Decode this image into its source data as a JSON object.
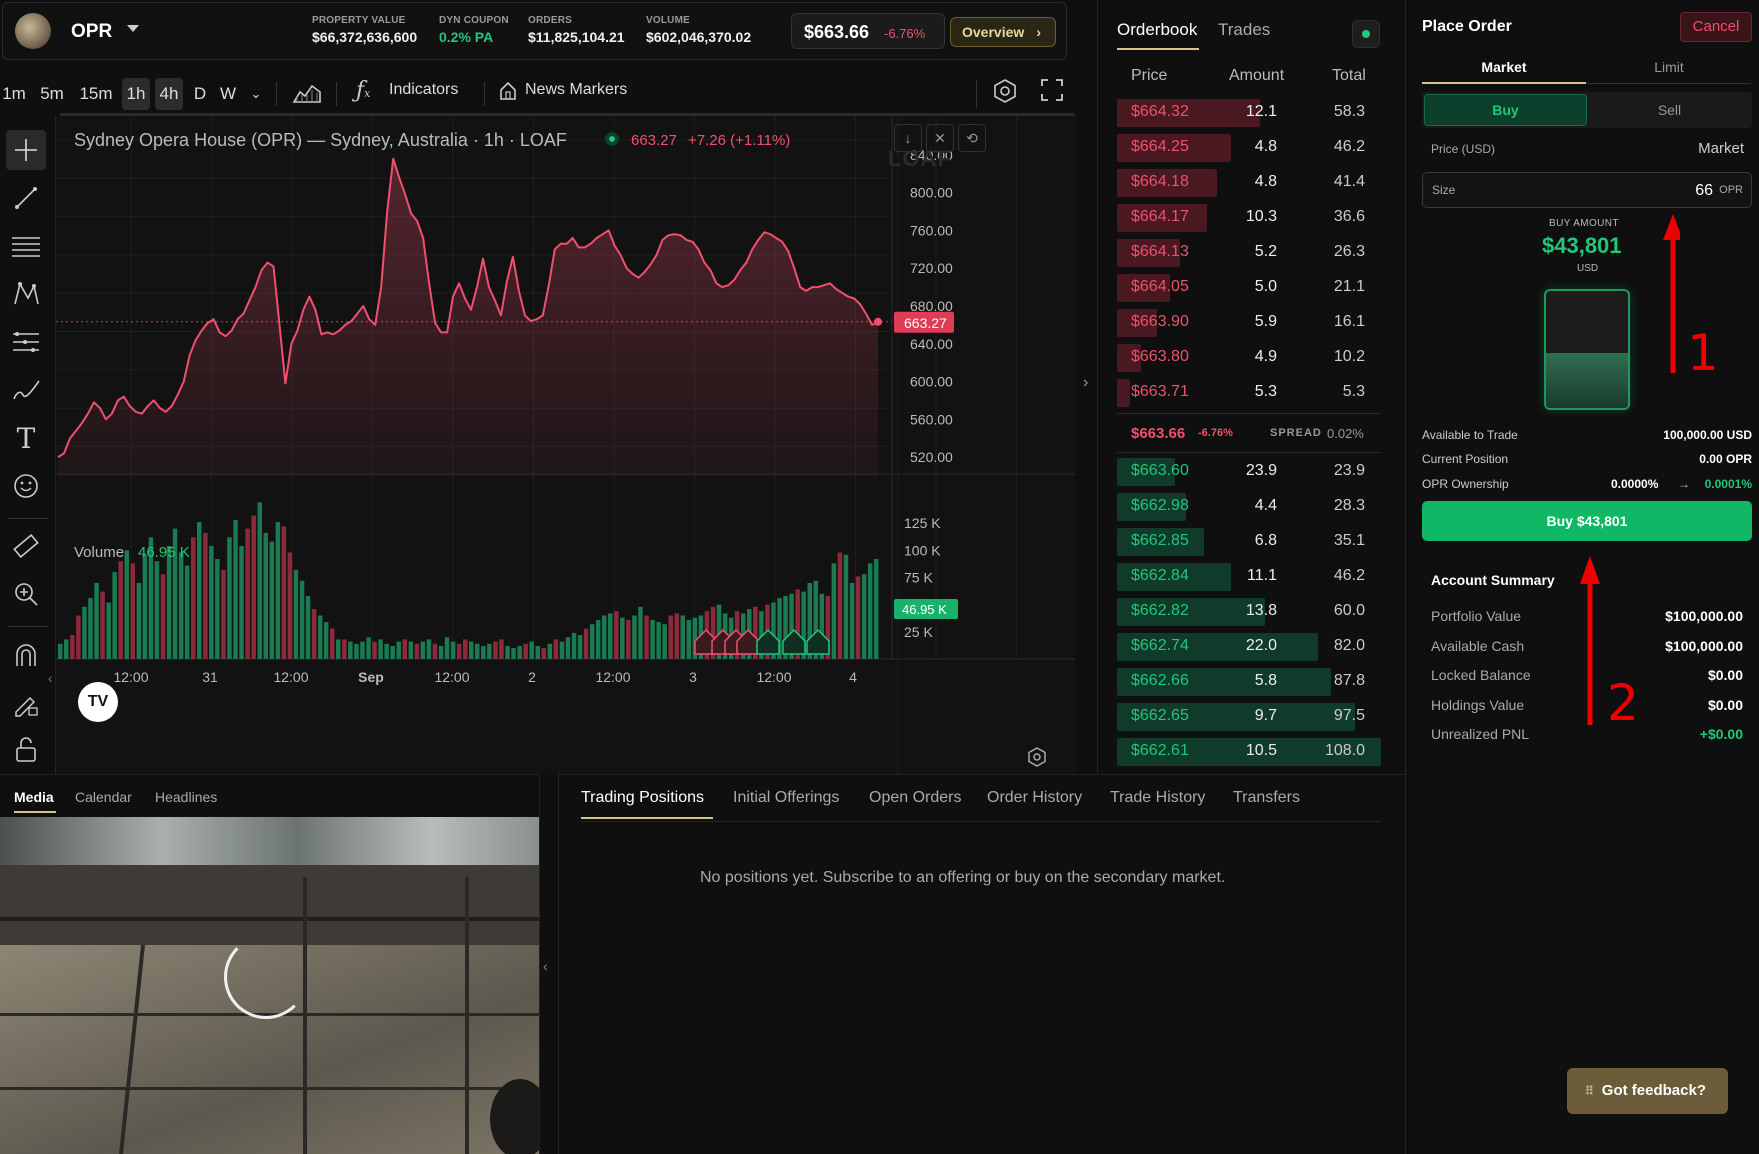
{
  "header": {
    "ticker": "OPR",
    "stats": [
      {
        "label": "PROPERTY VALUE",
        "value": "$66,372,636,600",
        "color": "#f0f0f0"
      },
      {
        "label": "DYN COUPON",
        "value": "0.2% PA",
        "color": "#21c77a"
      },
      {
        "label": "ORDERS",
        "value": "$11,825,104.21",
        "color": "#f0f0f0"
      },
      {
        "label": "VOLUME",
        "value": "$602,046,370.02",
        "color": "#f0f0f0"
      }
    ],
    "price": "$663.66",
    "change": "-6.76%",
    "overview_label": "Overview"
  },
  "toolbar": {
    "timeframes": [
      "1m",
      "5m",
      "15m",
      "1h",
      "4h",
      "D",
      "W"
    ],
    "active_timeframes": [
      "1h",
      "4h"
    ],
    "indicators_label": "Indicators",
    "news_markers_label": "News Markers"
  },
  "chart": {
    "title": "Sydney Opera House (OPR) — Sydney, Australia · 1h · LOAF",
    "last": "663.27",
    "change": "+7.26 (+1.11%)",
    "watermark": "LOAF",
    "price_ticks": [
      "840.00",
      "800.00",
      "760.00",
      "720.00",
      "680.00",
      "640.00",
      "600.00",
      "560.00",
      "520.00"
    ],
    "current_price_tag": "663.27",
    "volume_label": "Volume",
    "volume_value": "46.95 K",
    "volume_ticks": [
      "125 K",
      "100 K",
      "75 K",
      "25 K"
    ],
    "volume_tag": "46.95 K",
    "time_ticks": [
      "12:00",
      "31",
      "12:00",
      "Sep",
      "12:00",
      "2",
      "12:00",
      "3",
      "12:00",
      "4"
    ]
  },
  "chart_data": [
    {
      "type": "area",
      "title": "Sydney Opera House (OPR) — Sydney, Australia · 1h · LOAF",
      "ylim": [
        500,
        860
      ],
      "values": [
        520,
        524,
        540,
        548,
        556,
        566,
        578,
        572,
        560,
        566,
        580,
        584,
        574,
        568,
        566,
        574,
        580,
        572,
        568,
        574,
        586,
        600,
        628,
        644,
        654,
        662,
        666,
        652,
        648,
        654,
        666,
        672,
        686,
        700,
        718,
        726,
        722,
        660,
        598,
        640,
        654,
        676,
        690,
        676,
        650,
        652,
        650,
        654,
        660,
        664,
        672,
        680,
        666,
        660,
        700,
        780,
        836,
        816,
        798,
        778,
        770,
        752,
        704,
        662,
        652,
        652,
        690,
        704,
        688,
        676,
        700,
        730,
        700,
        686,
        670,
        706,
        732,
        696,
        670,
        664,
        666,
        670,
        702,
        740,
        746,
        746,
        752,
        742,
        742,
        746,
        752,
        756,
        760,
        744,
        734,
        720,
        714,
        710,
        716,
        724,
        734,
        750,
        755,
        756,
        755,
        750,
        748,
        740,
        726,
        718,
        704,
        700,
        702,
        708,
        718,
        726,
        740,
        750,
        758,
        756,
        752,
        748,
        738,
        720,
        700,
        696,
        700,
        700,
        702,
        704,
        698,
        694,
        690,
        688,
        682,
        672,
        660,
        663.27
      ]
    },
    {
      "type": "bar",
      "title": "Volume",
      "ylim": [
        0,
        150
      ],
      "values": [
        14,
        18,
        22,
        40,
        48,
        56,
        70,
        62,
        52,
        80,
        90,
        100,
        88,
        70,
        96,
        112,
        90,
        78,
        104,
        120,
        98,
        86,
        112,
        126,
        116,
        104,
        92,
        82,
        112,
        128,
        104,
        120,
        132,
        144,
        116,
        108,
        126,
        122,
        98,
        82,
        72,
        58,
        46,
        40,
        34,
        28,
        18,
        18,
        16,
        14,
        16,
        20,
        16,
        18,
        14,
        12,
        16,
        18,
        16,
        14,
        16,
        18,
        14,
        12,
        20,
        16,
        14,
        18,
        16,
        14,
        12,
        14,
        16,
        18,
        12,
        10,
        12,
        14,
        16,
        12,
        10,
        14,
        18,
        16,
        20,
        24,
        22,
        28,
        32,
        36,
        40,
        42,
        44,
        38,
        36,
        40,
        48,
        40,
        36,
        34,
        32,
        40,
        42,
        40,
        36,
        38,
        40,
        44,
        48,
        50,
        42,
        38,
        44,
        42,
        46,
        48,
        44,
        50,
        52,
        56,
        58,
        60,
        64,
        62,
        70,
        72,
        60,
        58,
        88,
        98,
        96,
        70,
        76,
        78,
        88,
        92
      ]
    }
  ],
  "orderbook": {
    "tabs": [
      "Orderbook",
      "Trades"
    ],
    "columns": [
      "Price",
      "Amount",
      "Total"
    ],
    "asks": [
      {
        "price": "$664.32",
        "amount": "12.1",
        "total": "58.3",
        "depth": 0.54
      },
      {
        "price": "$664.25",
        "amount": "4.8",
        "total": "46.2",
        "depth": 0.43
      },
      {
        "price": "$664.18",
        "amount": "4.8",
        "total": "41.4",
        "depth": 0.38
      },
      {
        "price": "$664.17",
        "amount": "10.3",
        "total": "36.6",
        "depth": 0.34
      },
      {
        "price": "$664.13",
        "amount": "5.2",
        "total": "26.3",
        "depth": 0.24
      },
      {
        "price": "$664.05",
        "amount": "5.0",
        "total": "21.1",
        "depth": 0.2
      },
      {
        "price": "$663.90",
        "amount": "5.9",
        "total": "16.1",
        "depth": 0.15
      },
      {
        "price": "$663.80",
        "amount": "4.9",
        "total": "10.2",
        "depth": 0.09
      },
      {
        "price": "$663.71",
        "amount": "5.3",
        "total": "5.3",
        "depth": 0.05
      }
    ],
    "mid_price": "$663.66",
    "mid_change": "-6.76%",
    "spread_label": "SPREAD",
    "spread_value": "0.02%",
    "bids": [
      {
        "price": "$663.60",
        "amount": "23.9",
        "total": "23.9",
        "depth": 0.22
      },
      {
        "price": "$662.98",
        "amount": "4.4",
        "total": "28.3",
        "depth": 0.26
      },
      {
        "price": "$662.85",
        "amount": "6.8",
        "total": "35.1",
        "depth": 0.33
      },
      {
        "price": "$662.84",
        "amount": "11.1",
        "total": "46.2",
        "depth": 0.43
      },
      {
        "price": "$662.82",
        "amount": "13.8",
        "total": "60.0",
        "depth": 0.56
      },
      {
        "price": "$662.74",
        "amount": "22.0",
        "total": "82.0",
        "depth": 0.76
      },
      {
        "price": "$662.66",
        "amount": "5.8",
        "total": "87.8",
        "depth": 0.81
      },
      {
        "price": "$662.65",
        "amount": "9.7",
        "total": "97.5",
        "depth": 0.9
      },
      {
        "price": "$662.61",
        "amount": "10.5",
        "total": "108.0",
        "depth": 1.0
      }
    ]
  },
  "place_order": {
    "title": "Place Order",
    "cancel_label": "Cancel",
    "type_tabs": [
      "Market",
      "Limit"
    ],
    "side_tabs": [
      "Buy",
      "Sell"
    ],
    "price_label": "Price (USD)",
    "price_value": "Market",
    "size_label": "Size",
    "size_value": "66",
    "size_unit": "OPR",
    "buy_amount_label": "BUY AMOUNT",
    "buy_amount_value": "$43,801",
    "buy_amount_unit": "USD",
    "fill_level": 0.47,
    "available_label": "Available to Trade",
    "available_value": "100,000.00 USD",
    "position_label": "Current Position",
    "position_value": "0.00 OPR",
    "ownership_label": "OPR Ownership",
    "ownership_from": "0.0000%",
    "ownership_arrow": "→",
    "ownership_to": "0.0001%",
    "buy_button": "Buy $43,801"
  },
  "account_summary": {
    "title": "Account Summary",
    "rows": [
      {
        "label": "Portfolio Value",
        "value": "$100,000.00",
        "color": "#ffffff"
      },
      {
        "label": "Available Cash",
        "value": "$100,000.00",
        "color": "#ffffff"
      },
      {
        "label": "Locked Balance",
        "value": "$0.00",
        "color": "#ffffff"
      },
      {
        "label": "Holdings Value",
        "value": "$0.00",
        "color": "#ffffff"
      },
      {
        "label": "Unrealized PNL",
        "value": "+$0.00",
        "color": "#21c77a"
      }
    ]
  },
  "annotations": [
    "1",
    "2"
  ],
  "media_tabs": [
    "Media",
    "Calendar",
    "Headlines"
  ],
  "positions_tabs": [
    "Trading Positions",
    "Initial Offerings",
    "Open Orders",
    "Order History",
    "Trade History",
    "Transfers"
  ],
  "empty_positions": "No positions yet. Subscribe to an offering or buy on the secondary market.",
  "feedback_label": "Got feedback?",
  "colors": {
    "red": "#f0506e",
    "green": "#21c77a",
    "accent": "#d8c48a"
  }
}
